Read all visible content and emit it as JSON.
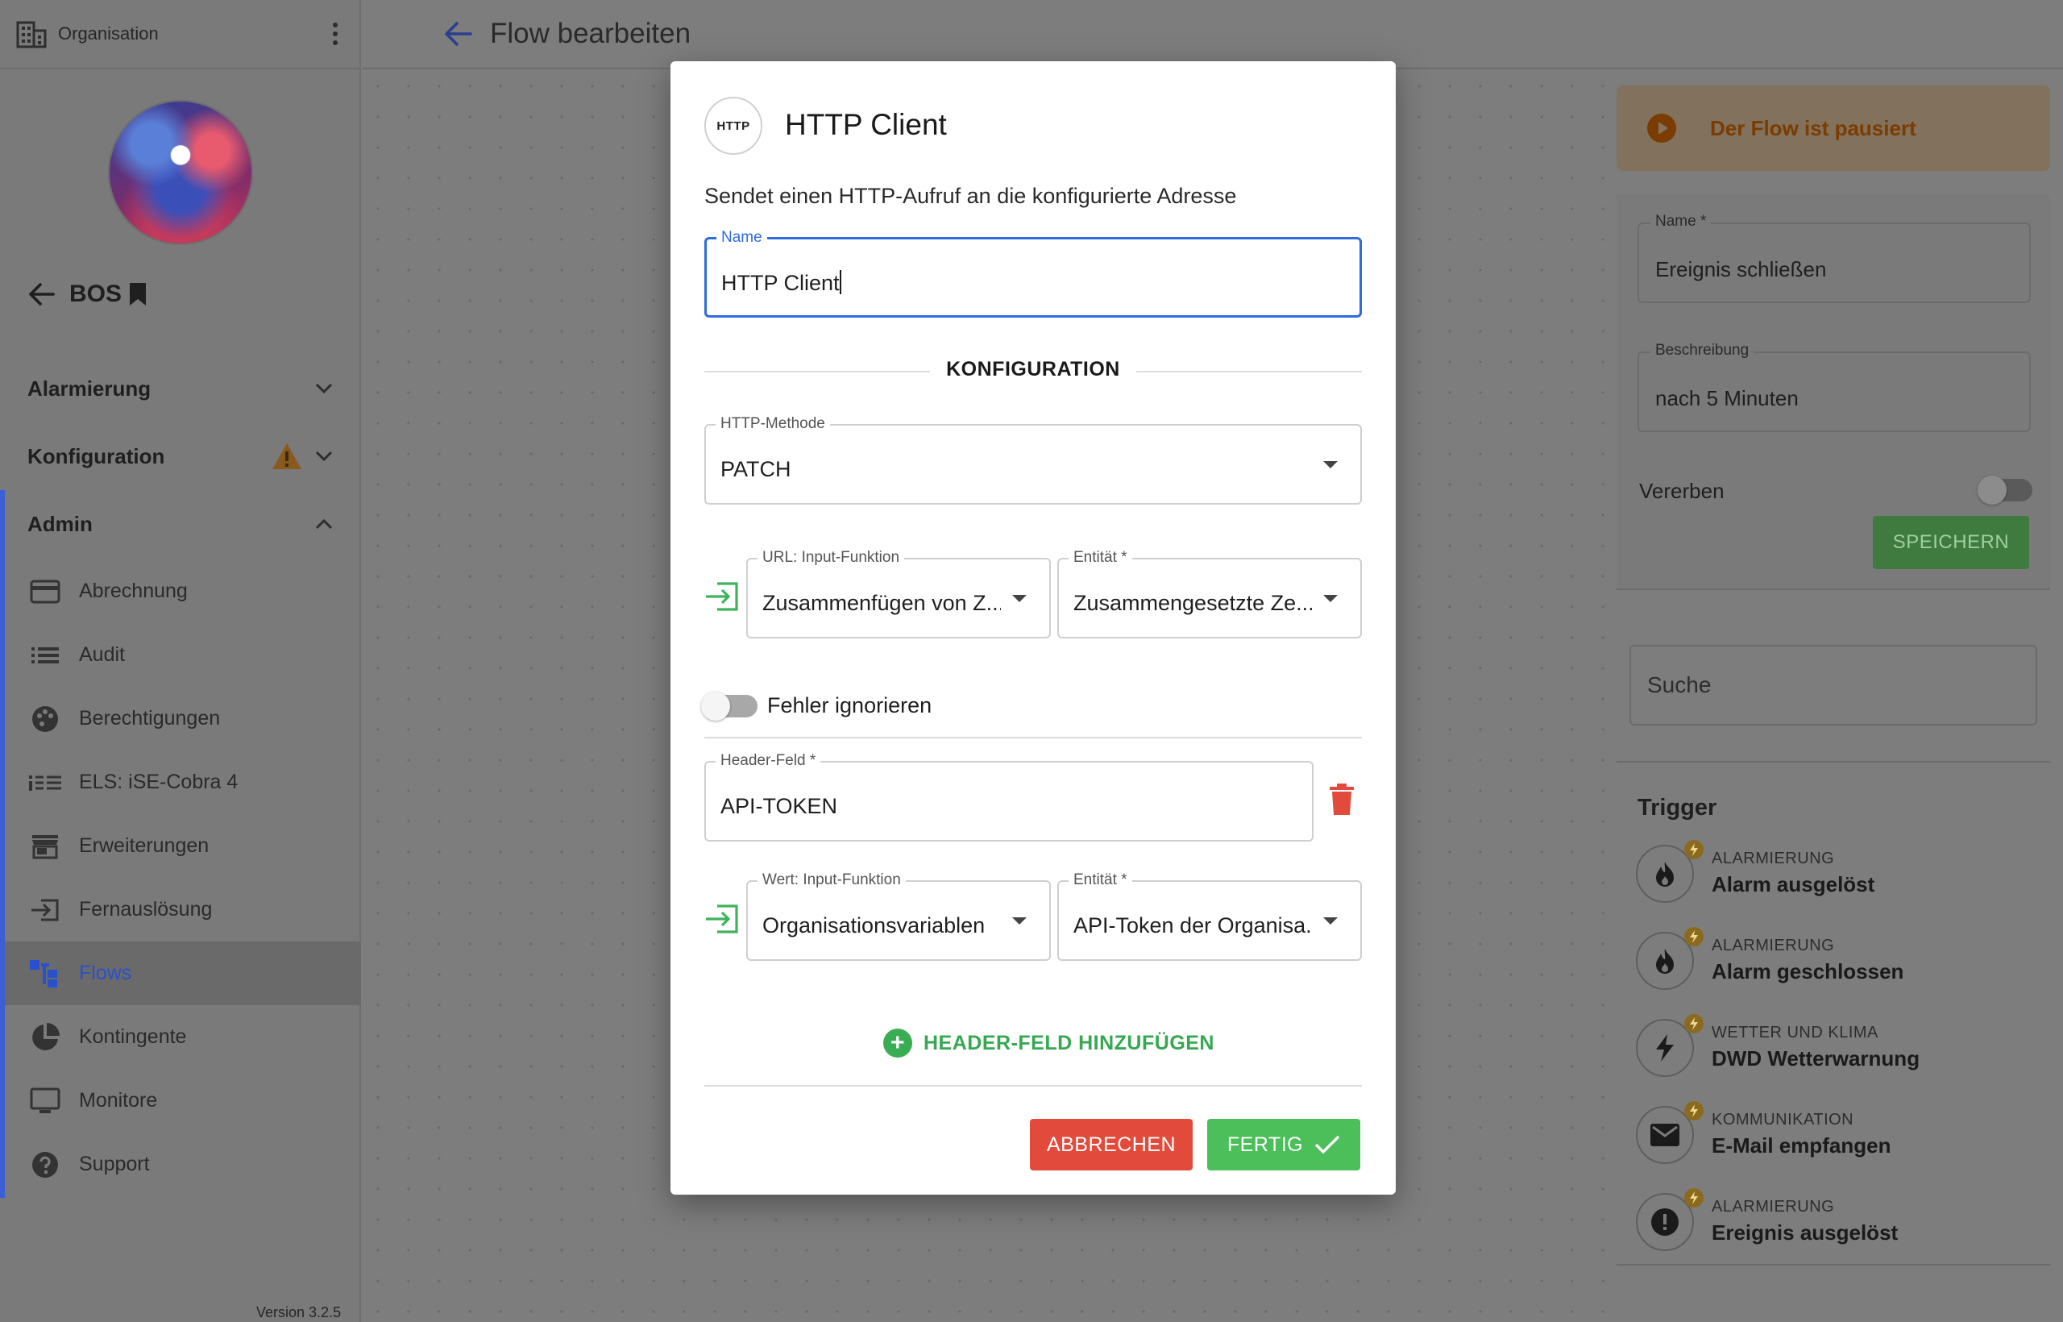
{
  "sidebar": {
    "org_label": "Organisation",
    "org_title": "BOS",
    "sections": {
      "alarmierung": "Alarmierung",
      "konfiguration": "Konfiguration",
      "admin": "Admin"
    },
    "items": [
      {
        "label": "Abrechnung",
        "icon": "credit-card-icon"
      },
      {
        "label": "Audit",
        "icon": "list-icon"
      },
      {
        "label": "Berechtigungen",
        "icon": "palette-icon"
      },
      {
        "label": "ELS: iSE-Cobra 4",
        "icon": "ise-logo-icon"
      },
      {
        "label": "Erweiterungen",
        "icon": "store-icon"
      },
      {
        "label": "Fernauslösung",
        "icon": "input-arrow-icon"
      },
      {
        "label": "Flows",
        "icon": "flow-icon"
      },
      {
        "label": "Kontingente",
        "icon": "pie-icon"
      },
      {
        "label": "Monitore",
        "icon": "monitor-icon"
      },
      {
        "label": "Support",
        "icon": "help-icon"
      }
    ],
    "version": "Version 3.2.5"
  },
  "header": {
    "title": "Flow bearbeiten"
  },
  "right_panel": {
    "paused": "Der Flow ist pausiert",
    "name_label": "Name *",
    "name_value": "Ereignis schließen",
    "desc_label": "Beschreibung",
    "desc_value": "nach 5 Minuten",
    "inherit_label": "Vererben",
    "save_label": "SPEICHERN",
    "search_placeholder": "Suche",
    "trigger_heading": "Trigger",
    "triggers": [
      {
        "category": "ALARMIERUNG",
        "name": "Alarm ausgelöst",
        "icon": "fire-icon"
      },
      {
        "category": "ALARMIERUNG",
        "name": "Alarm geschlossen",
        "icon": "fire-icon"
      },
      {
        "category": "WETTER UND KLIMA",
        "name": "DWD Wetterwarnung",
        "icon": "lightning-icon"
      },
      {
        "category": "KOMMUNIKATION",
        "name": "E-Mail empfangen",
        "icon": "mail-icon"
      },
      {
        "category": "ALARMIERUNG",
        "name": "Ereignis ausgelöst",
        "icon": "alert-circle-icon"
      }
    ]
  },
  "modal": {
    "logo_text": "HTTP",
    "title": "HTTP Client",
    "description": "Sendet einen HTTP-Aufruf an die konfigurierte Adresse",
    "name_label": "Name",
    "name_value": "HTTP Client",
    "section_heading": "KONFIGURATION",
    "method_label": "HTTP-Methode",
    "method_value": "PATCH",
    "url_func_label": "URL: Input-Funktion",
    "url_func_value": "Zusammenfügen von Z...",
    "url_entity_label": "Entität *",
    "url_entity_value": "Zusammengesetzte Ze...",
    "ignore_errors_label": "Fehler ignorieren",
    "header_field_label": "Header-Feld *",
    "header_field_value": "API-TOKEN",
    "value_func_label": "Wert: Input-Funktion",
    "value_func_value": "Organisationsvariablen",
    "value_entity_label": "Entität *",
    "value_entity_value": "API-Token der Organisa...",
    "add_header_label": "HEADER-FELD HINZUFÜGEN",
    "cancel_label": "ABBRECHEN",
    "done_label": "FERTIG"
  },
  "colors": {
    "accent_blue": "#2f6ce0",
    "success_green": "#4cbf5a",
    "danger_red": "#e24b3b",
    "warning_orange": "#e8893a"
  }
}
